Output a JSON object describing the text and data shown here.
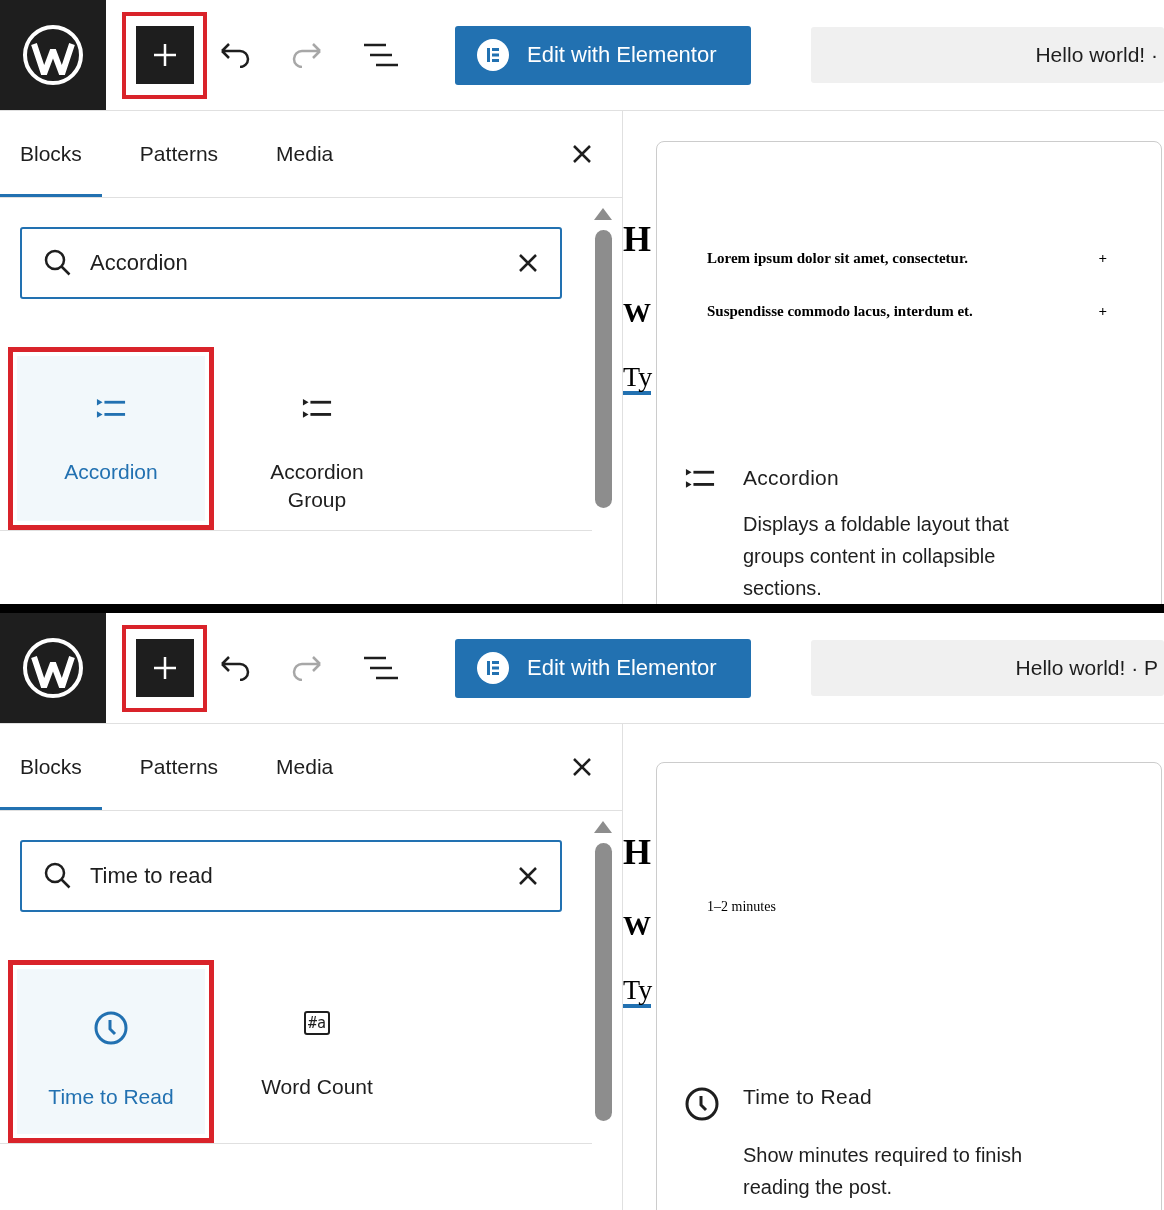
{
  "panels": [
    {
      "toolbar": {
        "inserter_highlighted": true,
        "redo_disabled": true,
        "elementor_label": "Edit with Elementor",
        "document_title": "Hello world! ·"
      },
      "tabs": [
        {
          "label": "Blocks",
          "selected": true
        },
        {
          "label": "Patterns",
          "selected": false
        },
        {
          "label": "Media",
          "selected": false
        }
      ],
      "search": {
        "value": "Accordion"
      },
      "blocks": [
        {
          "label": "Accordion",
          "kind": "accordion",
          "selected": true,
          "highlighted": true
        },
        {
          "label": "Accordion Group",
          "kind": "accordion",
          "selected": false,
          "highlighted": false
        }
      ],
      "editor_fragments": [
        "H",
        "W",
        "Ty"
      ],
      "preview": {
        "kind": "accordion",
        "items": [
          {
            "title": "Lorem ipsum dolor sit amet, consectetur.",
            "toggle": "+"
          },
          {
            "title": "Suspendisse commodo lacus, interdum et.",
            "toggle": "+"
          }
        ]
      },
      "info": {
        "kind": "accordion",
        "title": "Accordion",
        "description": "Displays a foldable layout that groups content in collapsible sections."
      }
    },
    {
      "toolbar": {
        "inserter_highlighted": true,
        "redo_disabled": true,
        "elementor_label": "Edit with Elementor",
        "document_title": "Hello world! · P"
      },
      "tabs": [
        {
          "label": "Blocks",
          "selected": true
        },
        {
          "label": "Patterns",
          "selected": false
        },
        {
          "label": "Media",
          "selected": false
        }
      ],
      "search": {
        "value": "Time to read"
      },
      "blocks": [
        {
          "label": "Time to Read",
          "kind": "clock",
          "selected": true,
          "highlighted": true
        },
        {
          "label": "Word Count",
          "kind": "wordcount",
          "icon_text": "#a",
          "selected": false,
          "highlighted": false
        }
      ],
      "editor_fragments": [
        "H",
        "W",
        "Ty"
      ],
      "preview": {
        "kind": "text",
        "text": "1–2 minutes"
      },
      "info": {
        "kind": "clock",
        "title": "Time to Read",
        "description": "Show minutes required to finish reading the post."
      }
    }
  ]
}
